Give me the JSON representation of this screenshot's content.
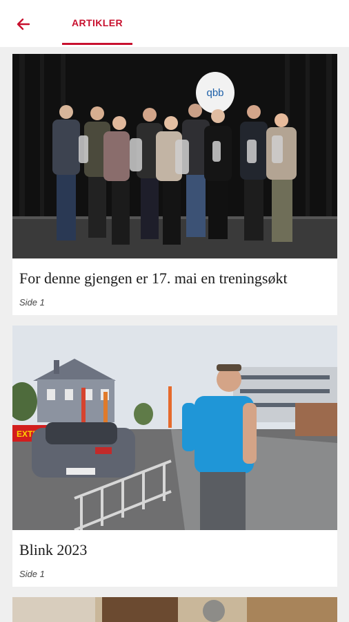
{
  "header": {
    "tab_label": "ARTIKLER"
  },
  "colors": {
    "accent": "#c8102e"
  },
  "articles": [
    {
      "title": "For denne gjengen er 17. mai en treningsøkt",
      "page": "Side 1",
      "image": "band-group-photo"
    },
    {
      "title": "Blink 2023",
      "page": "Side 1",
      "image": "man-street-photo"
    },
    {
      "image": "partial-photo"
    }
  ]
}
